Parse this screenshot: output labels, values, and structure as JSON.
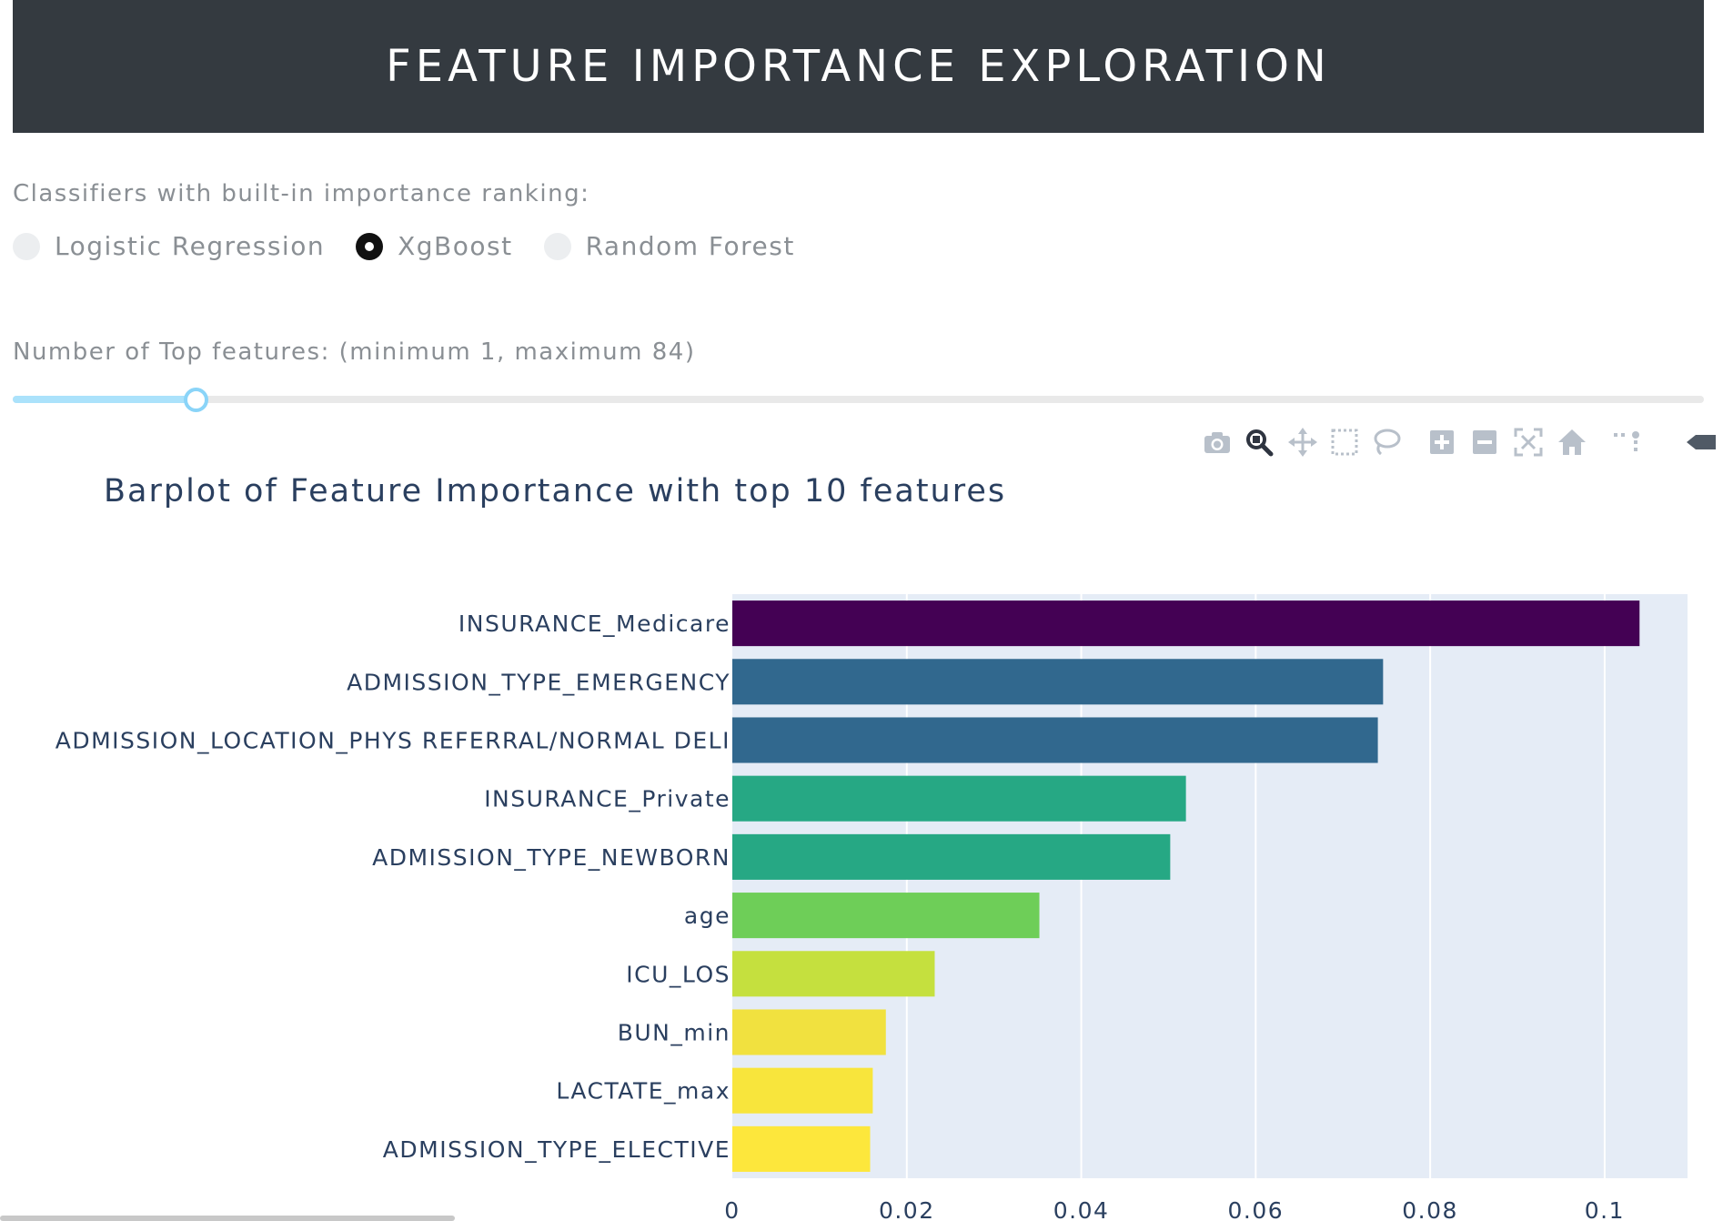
{
  "header": {
    "title": "FEATURE IMPORTANCE EXPLORATION"
  },
  "classifier": {
    "label": "Classifiers with built-in importance ranking:",
    "options": [
      {
        "label": "Logistic Regression",
        "checked": false
      },
      {
        "label": "XgBoost",
        "checked": true
      },
      {
        "label": "Random Forest",
        "checked": false
      }
    ]
  },
  "top_features": {
    "label": "Number of Top features: (minimum 1, maximum 84)",
    "min": 1,
    "max": 84,
    "value": 10
  },
  "modebar": {
    "icons": [
      "camera-icon",
      "zoom-icon",
      "pan-icon",
      "box-select-icon",
      "lasso-select-icon",
      "zoom-in-icon",
      "zoom-out-icon",
      "autoscale-icon",
      "reset-axes-icon",
      "spike-lines-icon",
      "hover-compare-icon"
    ]
  },
  "chart_data": {
    "type": "bar",
    "orientation": "horizontal",
    "title": "Barplot of Feature Importance with top 10 features",
    "categories": [
      "INSURANCE_Medicare",
      "ADMISSION_TYPE_EMERGENCY",
      "ADMISSION_LOCATION_PHYS REFERRAL/NORMAL DELI",
      "INSURANCE_Private",
      "ADMISSION_TYPE_NEWBORN",
      "age",
      "ICU_LOS",
      "BUN_min",
      "LACTATE_max",
      "ADMISSION_TYPE_ELECTIVE"
    ],
    "values": [
      0.104,
      0.0746,
      0.074,
      0.052,
      0.0502,
      0.0352,
      0.0232,
      0.0176,
      0.0161,
      0.0158
    ],
    "colors": [
      "#440154",
      "#31688e",
      "#31688e",
      "#26a884",
      "#26a884",
      "#6ece58",
      "#c5e03e",
      "#f1e13f",
      "#f8e53c",
      "#fde73c"
    ],
    "xlim": [
      0,
      0.1095
    ],
    "x_ticks": [
      0,
      0.02,
      0.04,
      0.06,
      0.08,
      0.1
    ],
    "x_tick_labels": [
      "0",
      "0.02",
      "0.04",
      "0.06",
      "0.08",
      "0.1"
    ],
    "plot_background": "#e5ecf6",
    "grid": true,
    "xlabel": "",
    "ylabel": ""
  }
}
